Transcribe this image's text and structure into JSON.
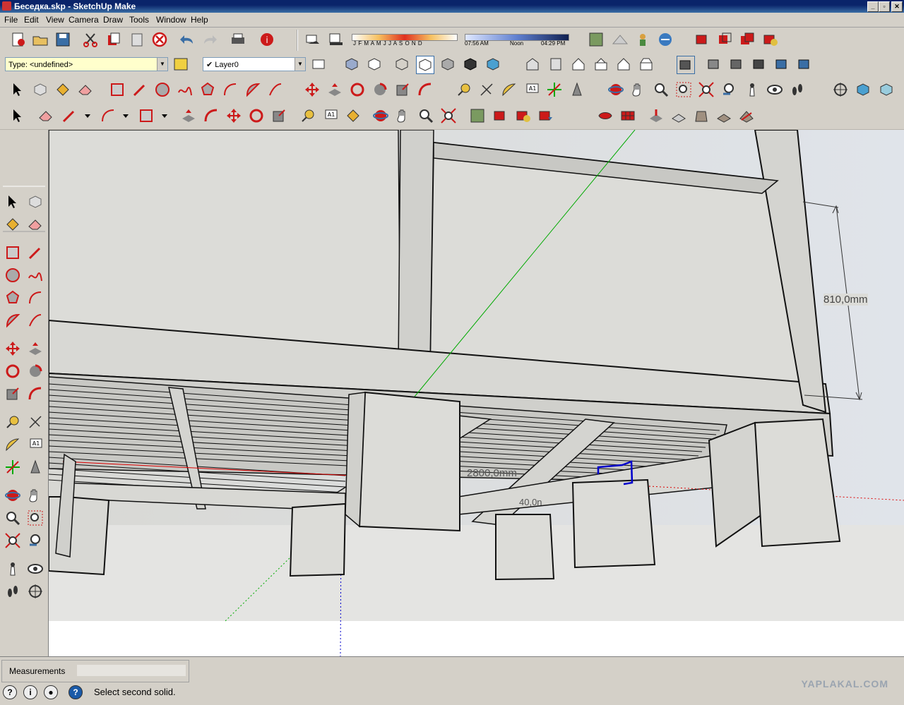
{
  "window": {
    "title": "Беседка.skp - SketchUp Make",
    "min": "_",
    "max": "▫",
    "close": "✕"
  },
  "menus": [
    "File",
    "Edit",
    "View",
    "Camera",
    "Draw",
    "Tools",
    "Window",
    "Help"
  ],
  "toolbar": {
    "type_combo": "Type: <undefined>",
    "layer_combo": "Layer0",
    "shadow_months": "J F M A M J J A S O N D",
    "time_start": "07:56 AM",
    "time_noon": "Noon",
    "time_end": "04:29 PM"
  },
  "viewport": {
    "dimension_vertical": "810,0mm",
    "dimension_length": "2800,0mm",
    "dimension_small": "40,0n"
  },
  "status": {
    "measurements_label": "Measurements",
    "measurements_value": "",
    "message": "Select second solid.",
    "watermark": "YAPLAKAL.COM"
  },
  "colors": {
    "accent_red": "#cc1a1a",
    "axis_green": "#00aa00",
    "axis_red": "#dd0000",
    "axis_blue": "#0000cc",
    "face_gray": "#dcdcd8"
  }
}
